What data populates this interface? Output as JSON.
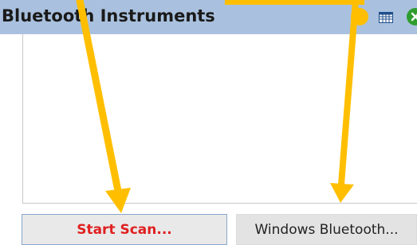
{
  "window": {
    "title": "Bluetooth Instruments"
  },
  "title_icons": {
    "help": "help-icon",
    "grid": "grid-icon",
    "close": "close-icon"
  },
  "buttons": {
    "start_scan": "Start Scan...",
    "windows_bluetooth": "Windows Bluetooth..."
  },
  "colors": {
    "titlebar": "#a9c1de",
    "arrow": "#ffbf00",
    "start_scan_text": "#e02020",
    "close_icon": "#2e9d2e"
  }
}
